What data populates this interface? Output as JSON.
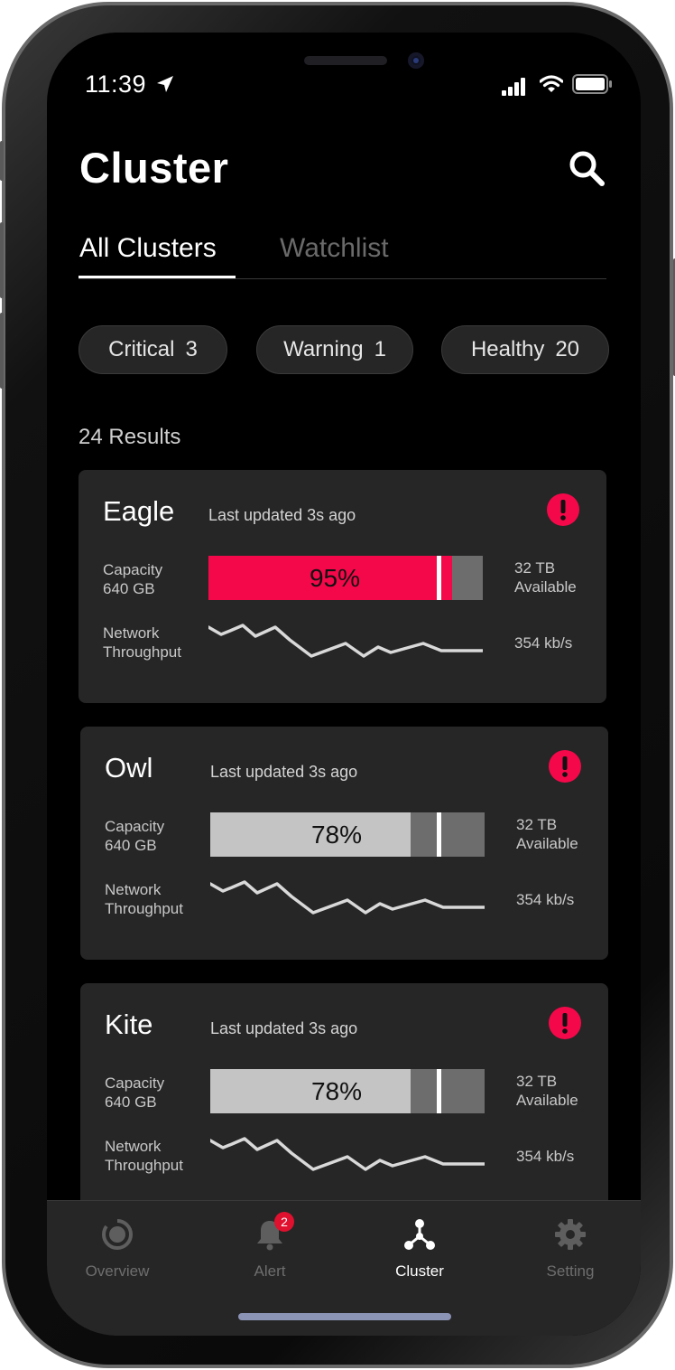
{
  "status_bar": {
    "time": "11:39"
  },
  "header": {
    "title": "Cluster"
  },
  "tabs": [
    {
      "label": "All Clusters",
      "active": true
    },
    {
      "label": "Watchlist",
      "active": false
    }
  ],
  "filters": [
    {
      "label": "Critical",
      "count": "3"
    },
    {
      "label": "Warning",
      "count": "1"
    },
    {
      "label": "Healthy",
      "count": "20"
    }
  ],
  "results_text": "24 Results",
  "clusters": [
    {
      "name": "Eagle",
      "updated": "Last updated 3s ago",
      "capacity_label": "Capacity",
      "capacity_size": "640 GB",
      "percent": "95%",
      "fill_ratio": 0.95,
      "fill_color": "#f5084a",
      "available_value": "32 TB",
      "available_label": "Available",
      "network_label_1": "Network",
      "network_label_2": "Throughput",
      "speed": "354 kb/s",
      "status": "critical"
    },
    {
      "name": "Owl",
      "updated": "Last updated 3s ago",
      "capacity_label": "Capacity",
      "capacity_size": "640 GB",
      "percent": "78%",
      "fill_ratio": 0.78,
      "fill_color": "#c4c4c4",
      "available_value": "32 TB",
      "available_label": "Available",
      "network_label_1": "Network",
      "network_label_2": "Throughput",
      "speed": "354 kb/s",
      "status": "critical"
    },
    {
      "name": "Kite",
      "updated": "Last updated 3s ago",
      "capacity_label": "Capacity",
      "capacity_size": "640 GB",
      "percent": "78%",
      "fill_ratio": 0.78,
      "fill_color": "#c4c4c4",
      "available_value": "32 TB",
      "available_label": "Available",
      "network_label_1": "Network",
      "network_label_2": "Throughput",
      "speed": "354 kb/s",
      "status": "critical"
    }
  ],
  "nav": [
    {
      "label": "Overview",
      "icon": "overview-icon",
      "active": false
    },
    {
      "label": "Alert",
      "icon": "bell-icon",
      "active": false,
      "badge": "2"
    },
    {
      "label": "Cluster",
      "icon": "cluster-icon",
      "active": true
    },
    {
      "label": "Setting",
      "icon": "gear-icon",
      "active": false
    }
  ],
  "colors": {
    "accent": "#f5084a",
    "card": "#262626",
    "background": "#000000"
  }
}
